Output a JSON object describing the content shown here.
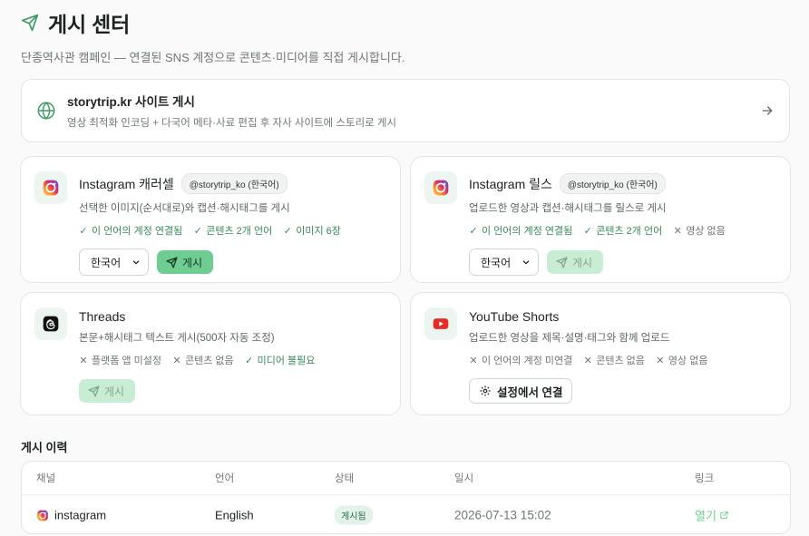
{
  "header": {
    "title": "게시 센터",
    "subtitle": "단종역사관 캠페인 — 연결된 SNS 계정으로 콘텐츠·미디어를 직접 게시합니다."
  },
  "site_card": {
    "title": "storytrip.kr 사이트 게시",
    "desc": "영상 최적화 인코딩 + 다국어 메타·사료 편집 후 자사 사이트에 스토리로 게시"
  },
  "cards": [
    {
      "title": "Instagram 캐러셀",
      "handle": "@storytrip_ko (한국어)",
      "desc": "선택한 이미지(순서대로)와 캡션·해시태그를 게시",
      "checks": [
        {
          "ok": true,
          "label": "이 언어의 계정 연결됨"
        },
        {
          "ok": true,
          "label": "콘텐츠 2개 언어"
        },
        {
          "ok": true,
          "label": "이미지 6장"
        }
      ],
      "language": "한국어",
      "post_label": "게시"
    },
    {
      "title": "Instagram 릴스",
      "handle": "@storytrip_ko (한국어)",
      "desc": "업로드한 영상과 캡션·해시태그를 릴스로 게시",
      "checks": [
        {
          "ok": true,
          "label": "이 언어의 계정 연결됨"
        },
        {
          "ok": true,
          "label": "콘텐츠 2개 언어"
        },
        {
          "ok": false,
          "label": "영상 없음"
        }
      ],
      "language": "한국어",
      "post_label": "게시"
    },
    {
      "title": "Threads",
      "desc": "본문+해시태그 텍스트 게시(500자 자동 조정)",
      "checks": [
        {
          "ok": false,
          "label": "플랫폼 앱 미설정"
        },
        {
          "ok": false,
          "label": "콘텐츠 없음"
        },
        {
          "ok": true,
          "label": "미디어 불필요"
        }
      ],
      "post_label": "게시"
    },
    {
      "title": "YouTube Shorts",
      "desc": "업로드한 영상을 제목·설명·태그와 함께 업로드",
      "checks": [
        {
          "ok": false,
          "label": "이 언어의 계정 미연결"
        },
        {
          "ok": false,
          "label": "콘텐츠 없음"
        },
        {
          "ok": false,
          "label": "영상 없음"
        }
      ],
      "settings_label": "설정에서 연결"
    }
  ],
  "history": {
    "title": "게시 이력",
    "columns": [
      "채널",
      "언어",
      "상태",
      "일시",
      "링크"
    ],
    "rows": [
      {
        "channel": "instagram",
        "language": "English",
        "status": "게시됨",
        "datetime": "2026-07-13 15:02",
        "link": "열기"
      }
    ]
  },
  "colors": {
    "accent": "#6fcd91",
    "ok_text": "#3a8a5c",
    "muted_text": "#6f7873",
    "instagram": "#d62976",
    "youtube": "#e52d27"
  },
  "icons": {
    "title": "send-icon",
    "site": "globe-icon",
    "site_arrow": "arrow-right-icon",
    "instagram": "instagram-icon",
    "threads": "threads-icon",
    "youtube": "youtube-icon",
    "settings": "gear-icon",
    "external": "external-link-icon"
  }
}
